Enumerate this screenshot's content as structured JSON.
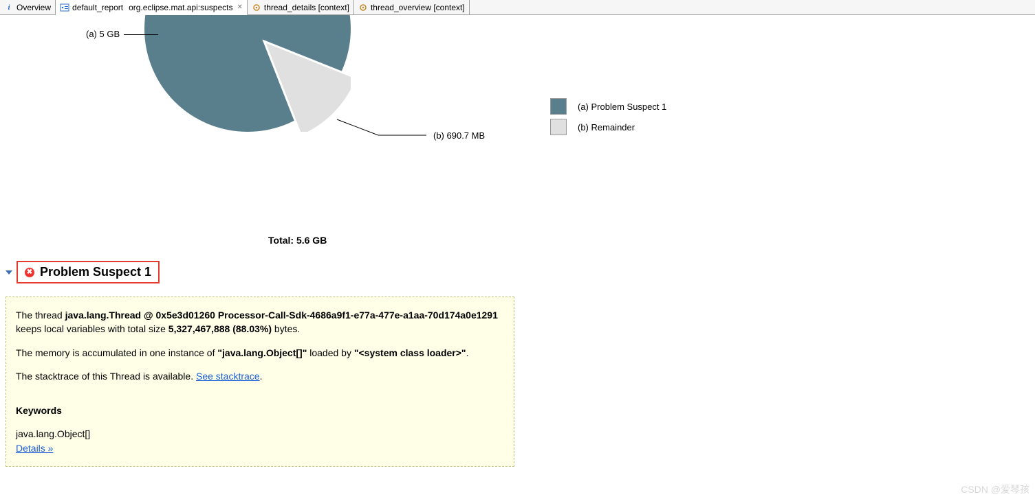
{
  "tabs": {
    "overview": "Overview",
    "default_report_prefix": "default_report",
    "default_report_suffix": "org.eclipse.mat.api:suspects",
    "thread_details": "thread_details [context]",
    "thread_overview": "thread_overview [context]"
  },
  "chart_data": {
    "type": "pie",
    "title": "",
    "series": [
      {
        "name": "(a)  Problem Suspect 1",
        "short": "(a)  5 GB",
        "value_bytes": 5327467888,
        "percent": 88.03,
        "color": "#5a7f8c"
      },
      {
        "name": "(b)  Remainder",
        "short": "(b)  690.7 MB",
        "value_bytes": 724200000,
        "percent": 11.97,
        "color": "#e0e0e0"
      }
    ],
    "total_label": "Total: 5.6 GB"
  },
  "legend": {
    "a": "(a)  Problem Suspect 1",
    "b": "(b)  Remainder"
  },
  "leader": {
    "a": "(a)  5 GB",
    "b": "(b)  690.7 MB"
  },
  "section": {
    "title": "Problem Suspect 1"
  },
  "desc": {
    "p1_pre": "The thread ",
    "p1_bold1": "java.lang.Thread @ 0x5e3d01260 Processor-Call-Sdk-4686a9f1-e77a-477e-a1aa-70d174a0e1291",
    "p1_mid": " keeps local variables with total size ",
    "p1_bold2": "5,327,467,888 (88.03%)",
    "p1_post": " bytes.",
    "p2_pre": "The memory is accumulated in one instance of ",
    "p2_bold1": "\"java.lang.Object[]\"",
    "p2_mid": " loaded by ",
    "p2_bold2": "\"<system class loader>\"",
    "p2_post": ".",
    "p3_pre": "The stacktrace of this Thread is available. ",
    "p3_link": "See stacktrace",
    "p3_post": ".",
    "kw_head": "Keywords",
    "kw_line": "java.lang.Object[]",
    "details_link": "Details »"
  },
  "watermark": "CSDN @爱琴孩"
}
